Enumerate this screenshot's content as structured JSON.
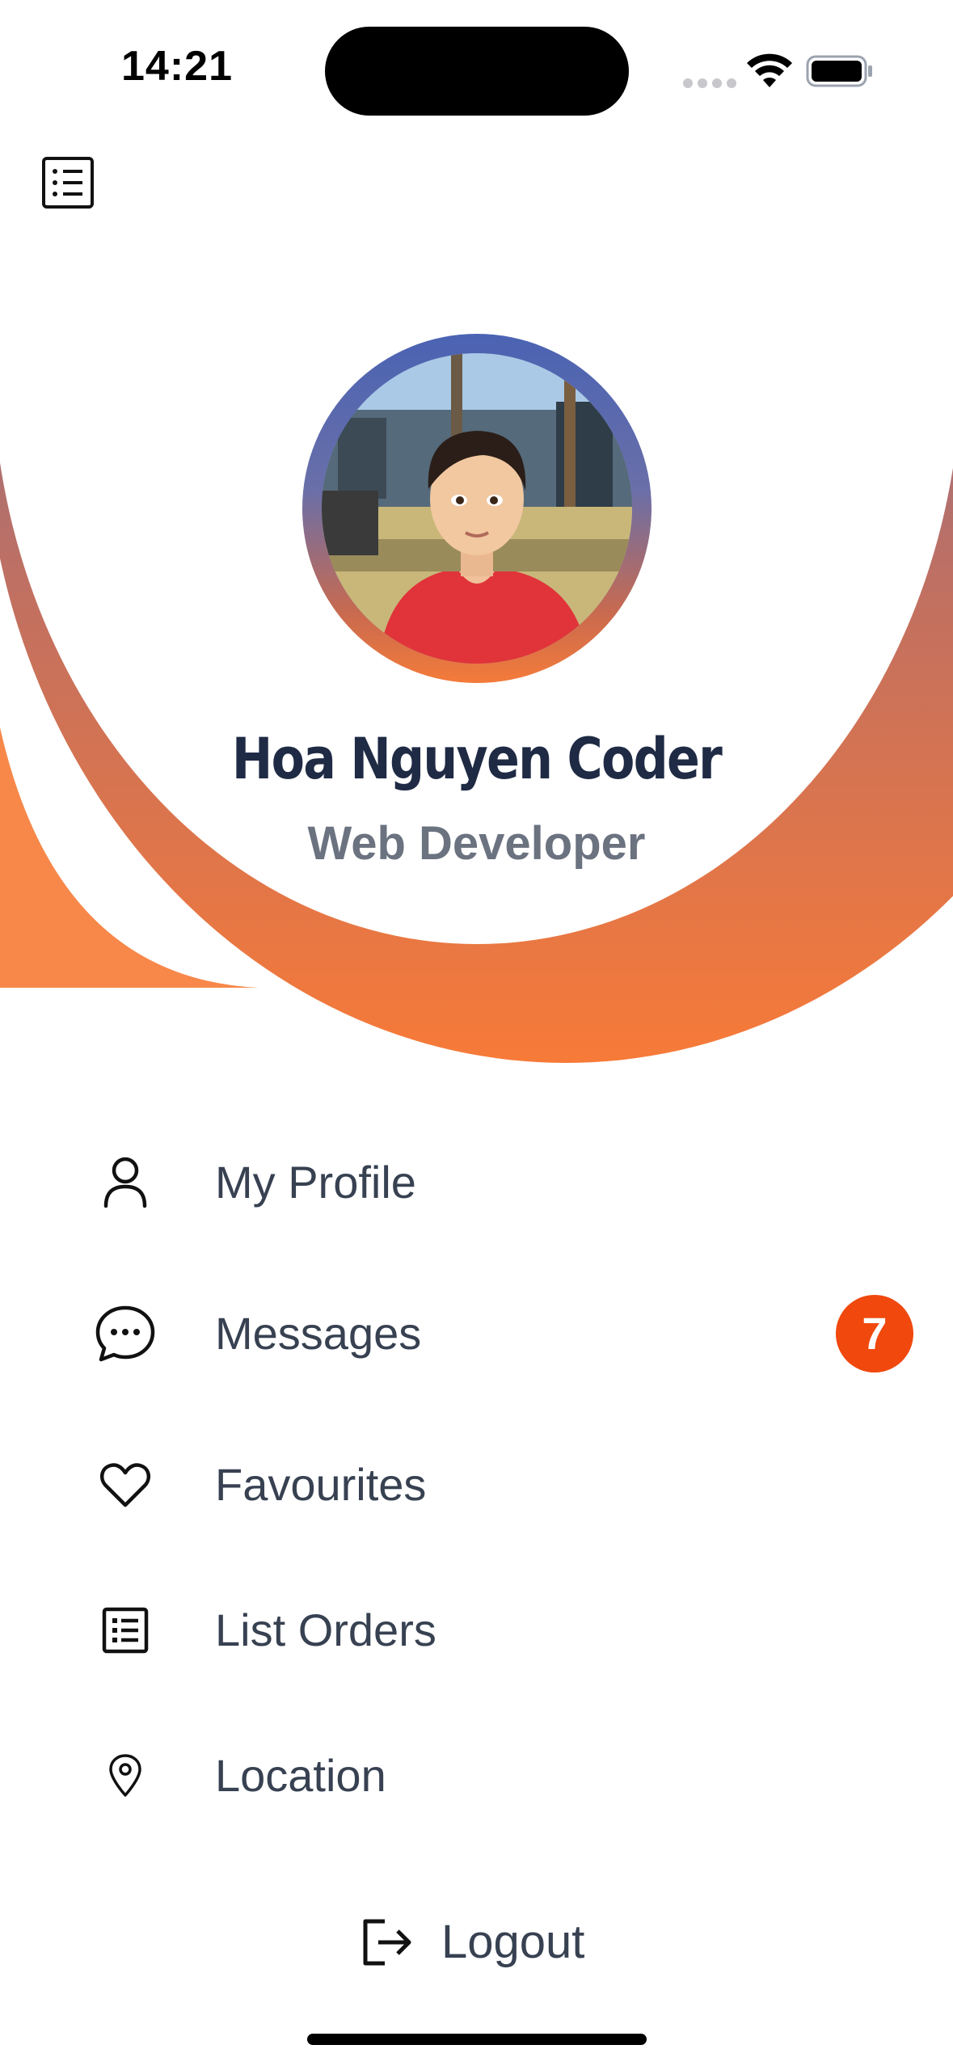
{
  "status_bar": {
    "time": "14:21"
  },
  "header": {
    "menu_icon": "list-icon"
  },
  "profile": {
    "name": "Hoa Nguyen Coder",
    "role": "Web Developer",
    "avatar": "user-avatar-photo"
  },
  "menu": {
    "items": [
      {
        "label": "My Profile",
        "icon": "user-icon"
      },
      {
        "label": "Messages",
        "icon": "chat-bubble-icon",
        "badge": "7"
      },
      {
        "label": "Favourites",
        "icon": "heart-icon"
      },
      {
        "label": "List Orders",
        "icon": "list-icon"
      },
      {
        "label": "Location",
        "icon": "map-pin-icon"
      }
    ]
  },
  "logout": {
    "label": "Logout",
    "icon": "logout-icon"
  },
  "colors": {
    "accent": "#f47b3a",
    "badge": "#f0480d",
    "name_text": "#1f2a44",
    "role_text": "#6b7280",
    "ring_top": "#4a63b3"
  }
}
